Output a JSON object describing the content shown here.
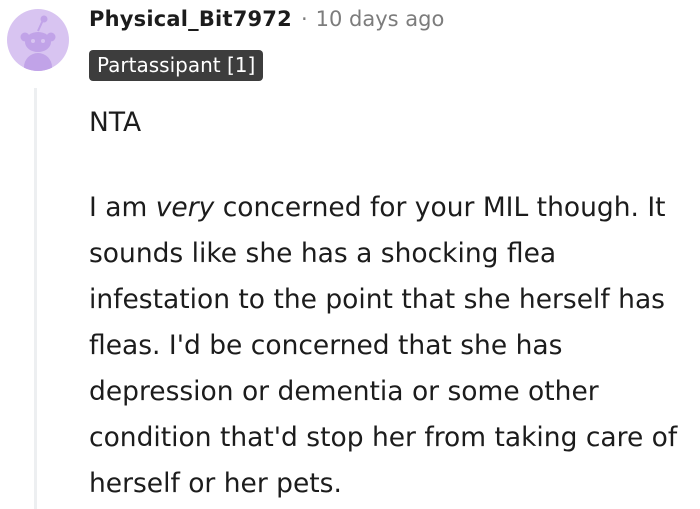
{
  "comment": {
    "username": "Physical_Bit7972",
    "separator": "·",
    "timestamp": "10 days ago",
    "flair": "Partassipant [1]",
    "avatar_icon": "snoo-avatar-icon",
    "avatar_bg": "#d8c4f1",
    "body": {
      "p1": "NTA",
      "p2_before": "I am ",
      "p2_emphasis": "very",
      "p2_after": " concerned for your MIL though. It sounds like she has a shocking flea infestation to the point that she herself has fleas. I'd be concerned that she has depression or dementia or some other condition that'd stop her from taking care of herself or her pets."
    }
  },
  "colors": {
    "text": "#1c1c1c",
    "meta": "#7c7c7c",
    "flair_bg": "#3d3d3d",
    "thread_line": "#edeff1"
  }
}
